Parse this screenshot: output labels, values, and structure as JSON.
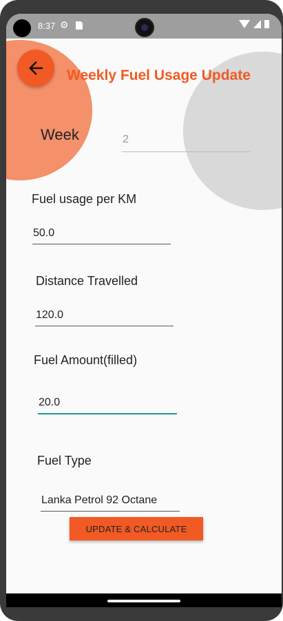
{
  "status_bar": {
    "time": "8:37"
  },
  "header": {
    "title": "Weekly Fuel Usage Update"
  },
  "week": {
    "label": "Week",
    "value": "2"
  },
  "fields": [
    {
      "label": "Fuel usage per KM",
      "value": "50.0"
    },
    {
      "label": "Distance Travelled",
      "value": "120.0"
    },
    {
      "label": "Fuel Amount(filled)",
      "value": "20.0"
    },
    {
      "label": "Fuel Type",
      "value": "Lanka Petrol 92 Octane"
    }
  ],
  "button": {
    "label": "UPDATE & CALCULATE"
  },
  "colors": {
    "accent": "#f15a24",
    "circle_orange": "#f4906a",
    "circle_grey": "#d9d9d9",
    "focus_underline": "#1a9a8f"
  }
}
